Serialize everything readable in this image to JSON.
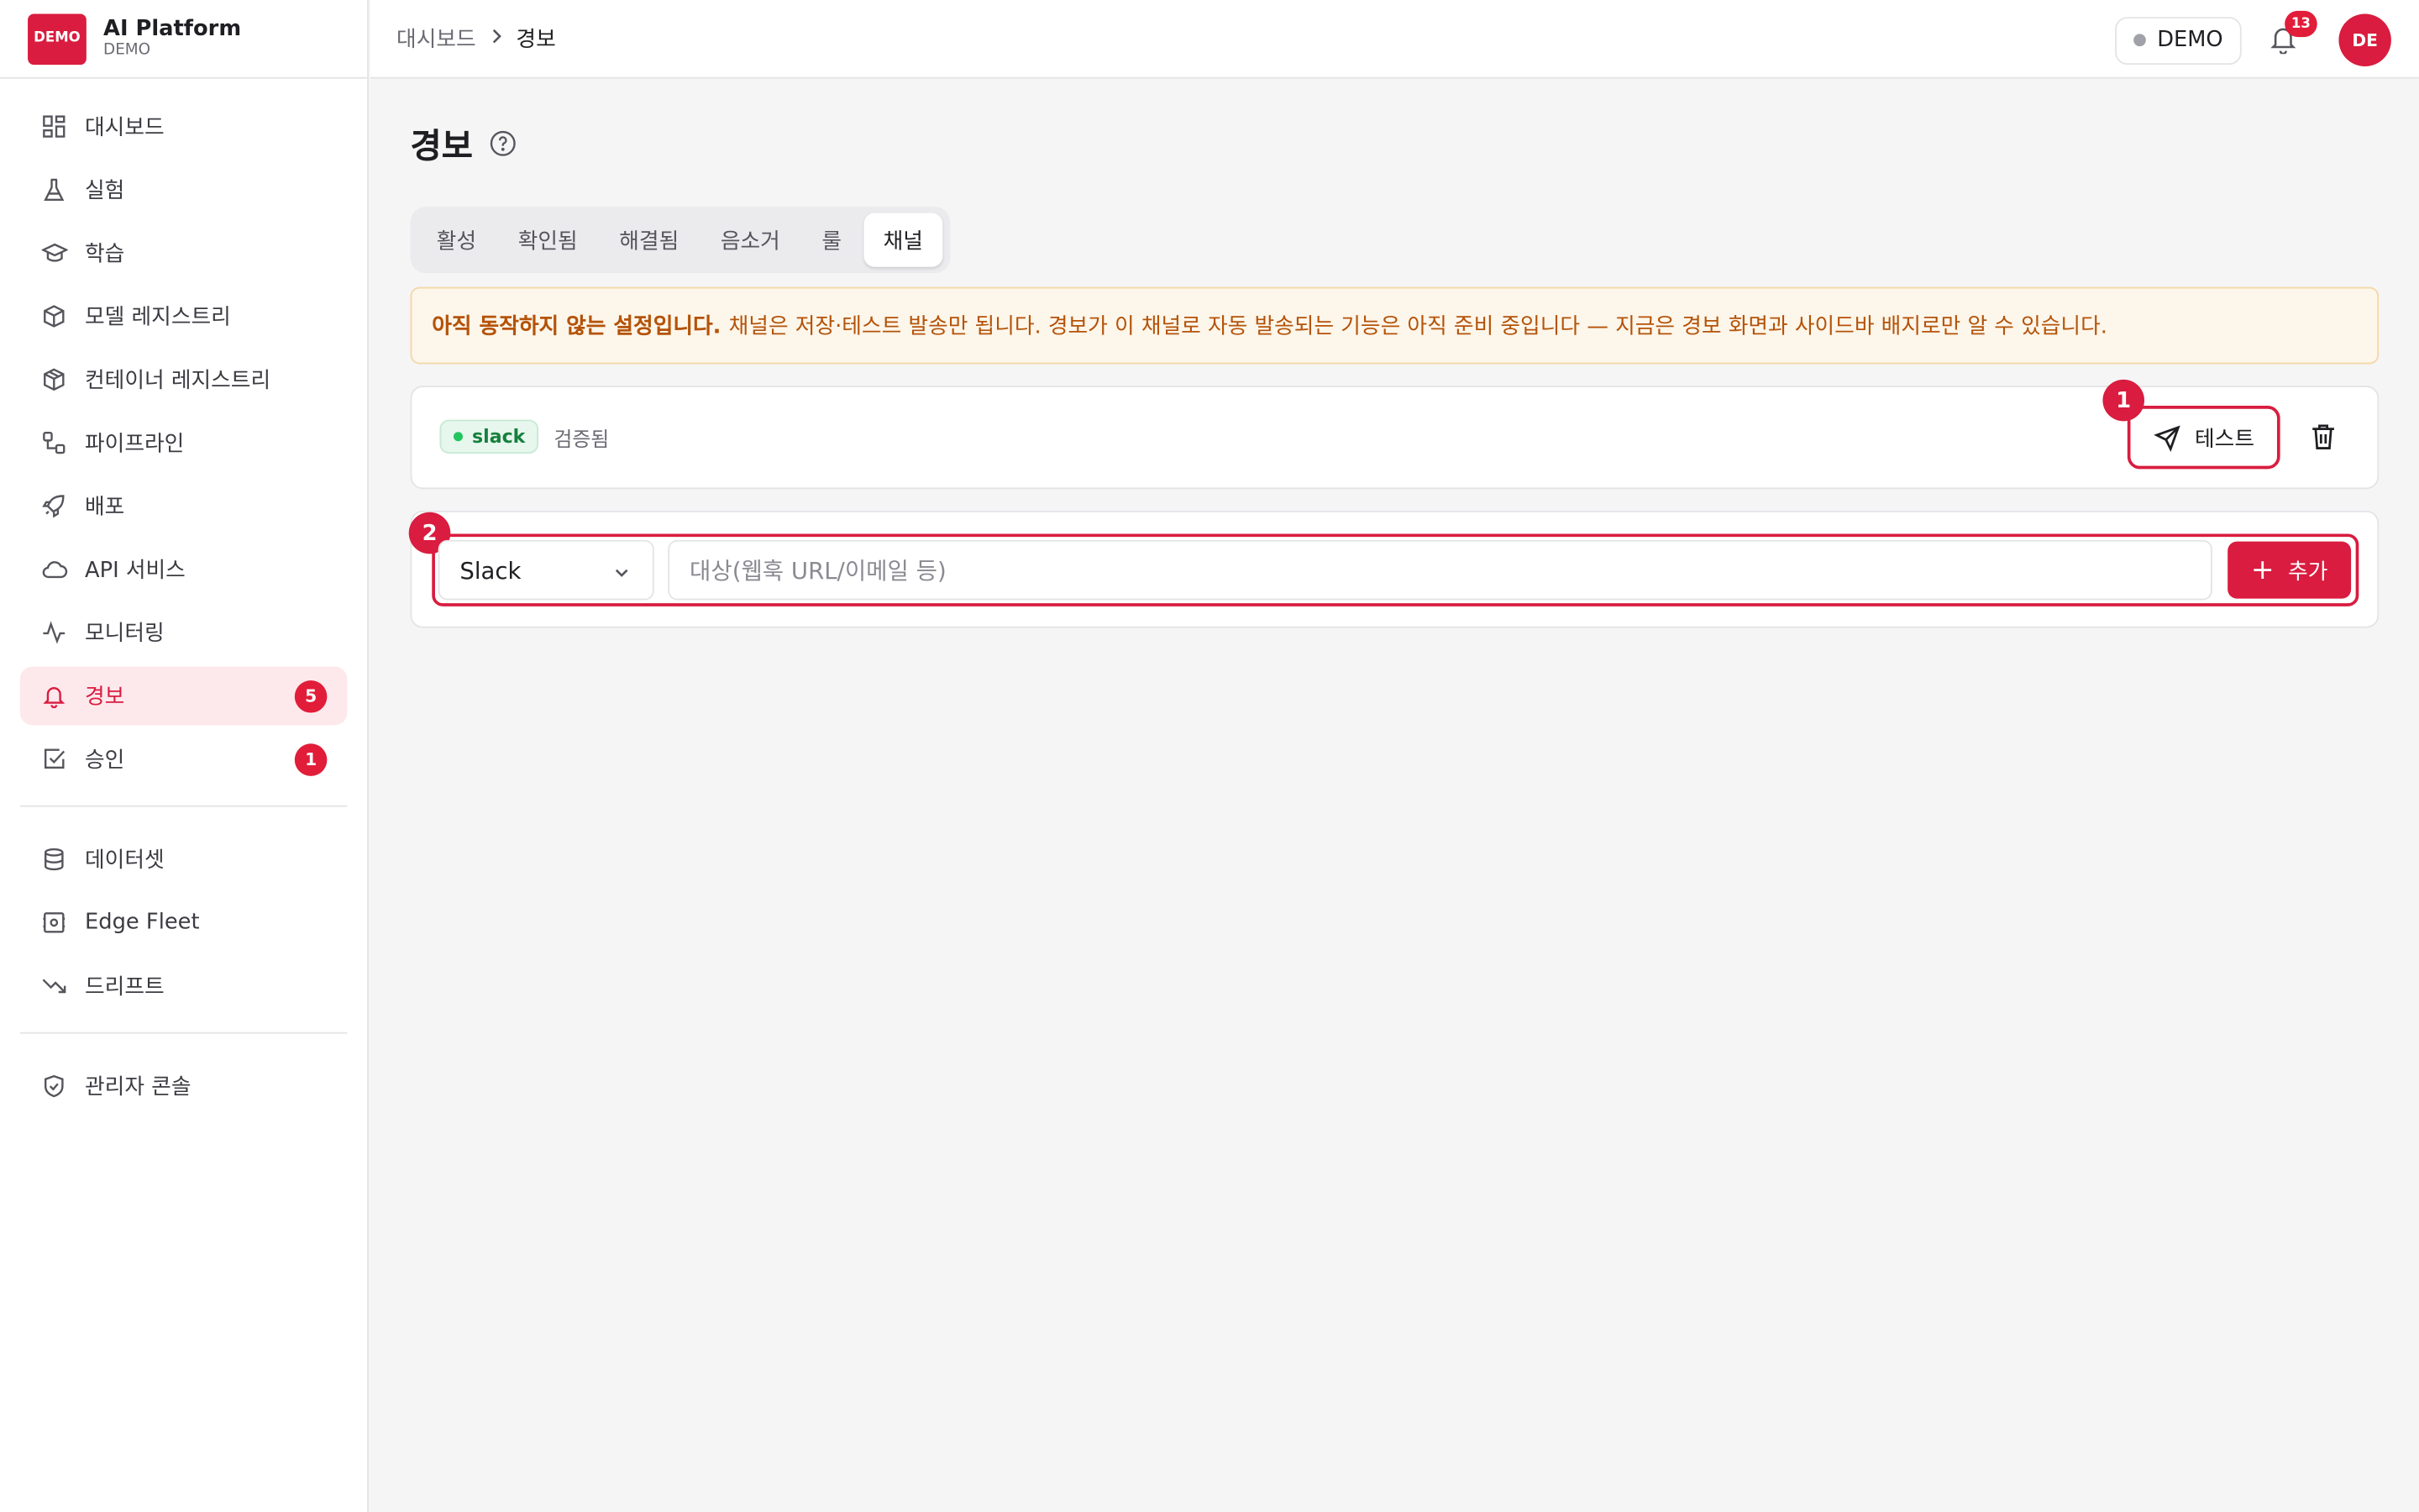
{
  "brand": {
    "logo": "DEMO",
    "name": "AI Platform",
    "sub": "DEMO"
  },
  "nav": {
    "primary": [
      {
        "label": "대시보드",
        "icon": "dashboard-icon"
      },
      {
        "label": "실험",
        "icon": "flask-icon"
      },
      {
        "label": "학습",
        "icon": "graduation-cap-icon"
      },
      {
        "label": "모델 레지스트리",
        "icon": "box-icon"
      },
      {
        "label": "컨테이너 레지스트리",
        "icon": "boxes-icon"
      },
      {
        "label": "파이프라인",
        "icon": "workflow-icon"
      },
      {
        "label": "배포",
        "icon": "rocket-icon"
      },
      {
        "label": "API 서비스",
        "icon": "cloud-icon"
      },
      {
        "label": "모니터링",
        "icon": "activity-icon"
      },
      {
        "label": "경보",
        "icon": "bell-icon",
        "badge": "5",
        "active": true
      },
      {
        "label": "승인",
        "icon": "check-square-icon",
        "badge": "1"
      }
    ],
    "secondary": [
      {
        "label": "데이터셋",
        "icon": "database-icon"
      },
      {
        "label": "Edge Fleet",
        "icon": "edge-device-icon"
      },
      {
        "label": "드리프트",
        "icon": "trending-down-icon"
      }
    ],
    "admin": [
      {
        "label": "관리자 콘솔",
        "icon": "shield-icon"
      }
    ]
  },
  "topbar": {
    "breadcrumb": [
      "대시보드",
      "경보"
    ],
    "env": "DEMO",
    "notifications": "13",
    "avatar": "DE"
  },
  "page": {
    "title": "경보",
    "tabs": [
      "활성",
      "확인됨",
      "해결됨",
      "음소거",
      "룰",
      "채널"
    ],
    "active_tab": "채널",
    "notice_bold": "아직 동작하지 않는 설정입니다.",
    "notice_text": "채널은 저장·테스트 발송만 됩니다. 경보가 이 채널로 자동 발송되는 기능은 아직 준비 중입니다 — 지금은 경보 화면과 사이드바 배지로만 알 수 있습니다."
  },
  "channel": {
    "type": "slack",
    "status": "검증됨",
    "test_label": "테스트"
  },
  "add_form": {
    "select_value": "Slack",
    "target_placeholder": "대상(웹훅 URL/이메일 등)",
    "add_label": "추가"
  },
  "markers": [
    "1",
    "2"
  ],
  "colors": {
    "accent": "#d91c3f",
    "notice_text": "#b45309",
    "success": "#16803c"
  }
}
